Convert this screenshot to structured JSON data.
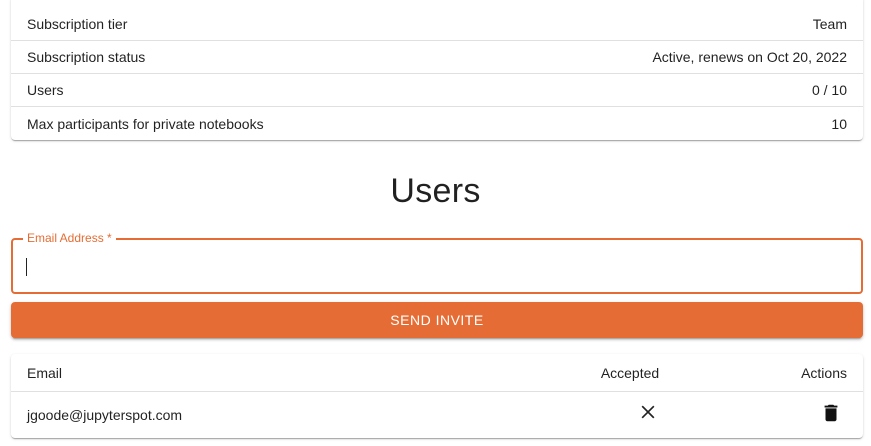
{
  "subscription": {
    "rows": [
      {
        "label": "Subscription tier",
        "value": "Team"
      },
      {
        "label": "Subscription status",
        "value": "Active, renews on Oct 20, 2022"
      },
      {
        "label": "Users",
        "value": "0 / 10"
      },
      {
        "label": "Max participants for private notebooks",
        "value": "10"
      }
    ]
  },
  "users_section": {
    "title": "Users",
    "email_field": {
      "label": "Email Address *",
      "value": "",
      "placeholder": ""
    },
    "send_button_label": "SEND INVITE"
  },
  "users_table": {
    "columns": [
      "Email",
      "Accepted",
      "Actions"
    ],
    "rows": [
      {
        "email": "jgoode@jupyterspot.com",
        "accepted_icon": "close-icon",
        "action_icon": "trash-icon"
      }
    ]
  },
  "colors": {
    "accent": "#e56d35"
  }
}
